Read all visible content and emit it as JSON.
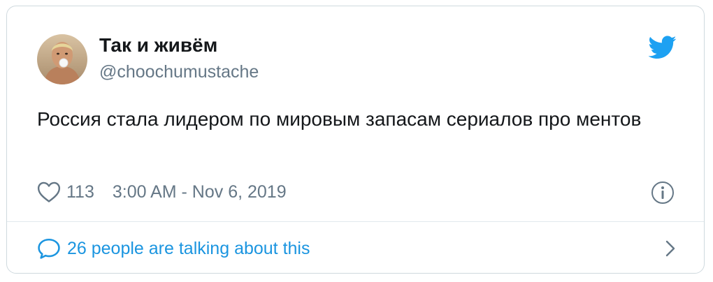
{
  "author": {
    "name": "Так и живём",
    "handle": "@choochumustache"
  },
  "tweet": {
    "text": "Россия стала лидером по мировым запасам сериалов про ментов"
  },
  "meta": {
    "likes": "113",
    "timestamp": "3:00 AM - Nov 6, 2019"
  },
  "footer": {
    "talking_label": "26 people are talking about this"
  },
  "icons": {
    "logo": "twitter-bird-icon",
    "like": "heart-icon",
    "info": "info-icon",
    "talk": "speech-bubble-icon",
    "more": "chevron-right-icon"
  },
  "colors": {
    "twitter_blue": "#1da1f2",
    "link_blue": "#1b95e0",
    "text": "#14171a",
    "muted": "#657786",
    "border": "#cfd9de"
  }
}
